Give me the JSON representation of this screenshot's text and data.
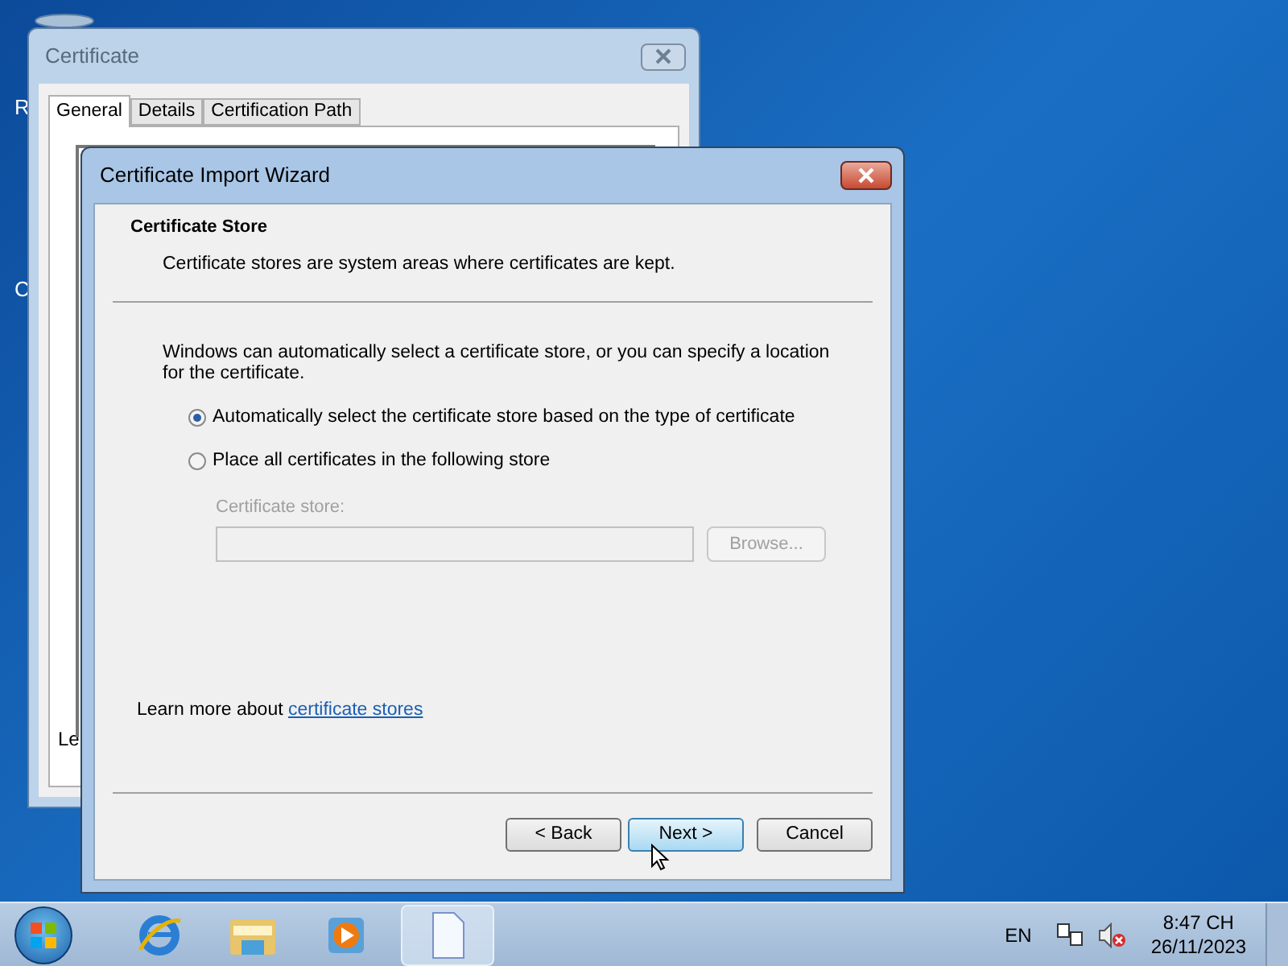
{
  "desktop": {
    "icon_labels": [
      "R",
      "C"
    ]
  },
  "back_window": {
    "title": "Certificate",
    "tabs": [
      {
        "label": "General",
        "selected": true
      },
      {
        "label": "Details",
        "selected": false
      },
      {
        "label": "Certification Path",
        "selected": false
      }
    ],
    "footer_text": "Le"
  },
  "wizard": {
    "title": "Certificate Import Wizard",
    "header": {
      "title": "Certificate Store",
      "subtitle": "Certificate stores are system areas where certificates are kept."
    },
    "intro": "Windows can automatically select a certificate store, or you can specify a location for the certificate.",
    "options": [
      {
        "label": "Automatically select the certificate store based on the type of certificate",
        "selected": true
      },
      {
        "label": "Place all certificates in the following store",
        "selected": false
      }
    ],
    "store_field": {
      "label": "Certificate store:",
      "disabled": true
    },
    "browse_button": {
      "label": "Browse...",
      "disabled": true
    },
    "learn_more": {
      "text": "Learn more about",
      "link": "certificate stores"
    },
    "buttons": [
      {
        "label": "< Back",
        "focused": false
      },
      {
        "label": "Next >",
        "focused": true
      },
      {
        "label": "Cancel",
        "focused": false
      }
    ]
  },
  "taskbar": {
    "language": "EN",
    "time": "8:47 CH",
    "date": "26/11/2023"
  }
}
